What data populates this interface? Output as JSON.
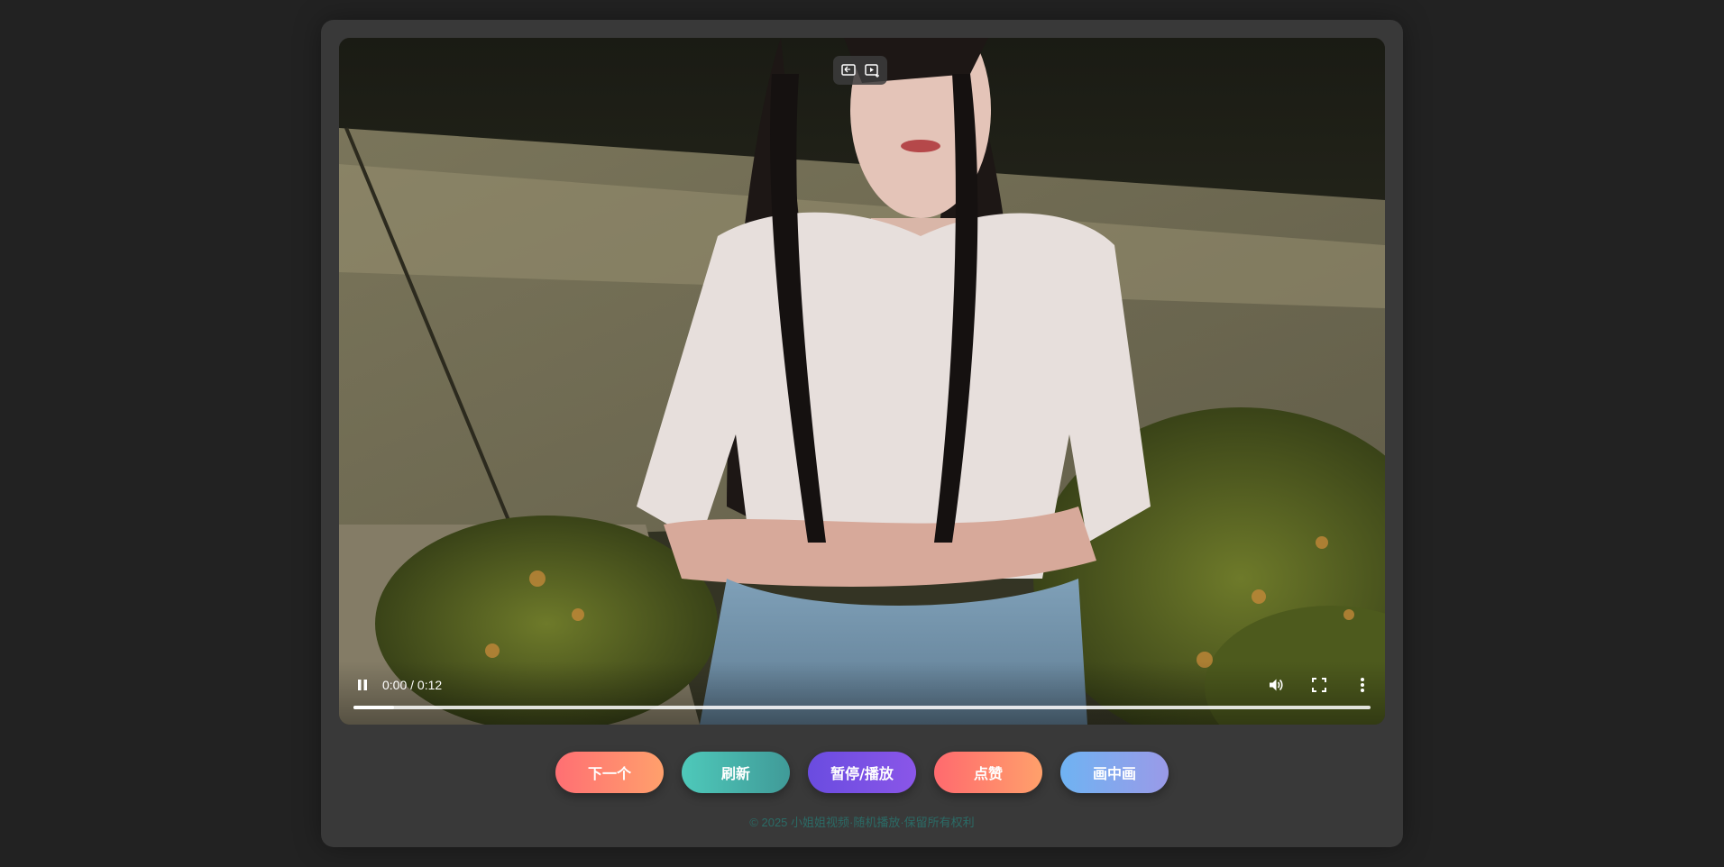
{
  "video": {
    "time_display": "0:00 / 0:12",
    "progress_fraction": 0.04,
    "state": "playing",
    "overlay_icons": [
      "screen-cast-icon",
      "picture-in-picture-sparkle-icon"
    ]
  },
  "controls": {
    "icons": [
      "pause-icon",
      "volume-icon",
      "fullscreen-icon",
      "more-options-icon"
    ]
  },
  "actions": {
    "next_label": "下一个",
    "refresh_label": "刷新",
    "pause_play_label": "暂停/播放",
    "like_label": "点赞",
    "pip_label": "画中画"
  },
  "footer": {
    "text": "© 2025 小姐姐视频·随机播放·保留所有权利"
  },
  "colors": {
    "page_background": "#222222",
    "card_background": "#393939",
    "footer_text": "#2b6b66"
  }
}
